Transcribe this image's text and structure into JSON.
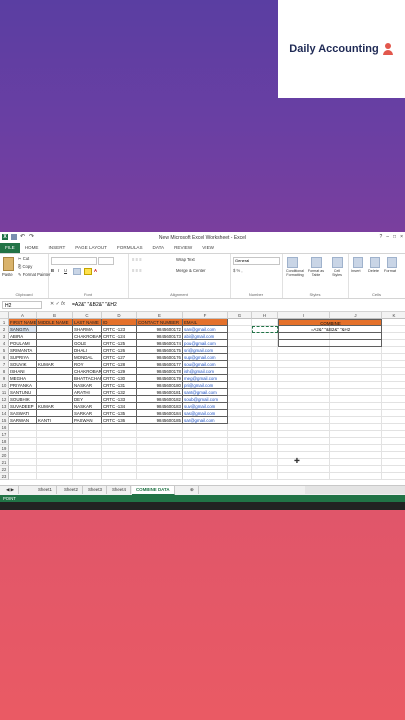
{
  "brand": {
    "name": "Daily Accounting"
  },
  "window": {
    "title": "New Microsoft Excel Worksheet - Excel"
  },
  "ribbon": {
    "tabs": [
      "FILE",
      "HOME",
      "INSERT",
      "PAGE LAYOUT",
      "FORMULAS",
      "DATA",
      "REVIEW",
      "VIEW"
    ],
    "paste": "Paste",
    "cut": "Cut",
    "copy": "Copy",
    "format_painter": "Format Painter",
    "wrap_text": "Wrap Text",
    "merge_center": "Merge & Center",
    "number_format": "General",
    "conditional_formatting": "Conditional Formatting",
    "format_as_table": "Format as Table",
    "cell_styles": "Cell Styles",
    "insert": "Insert",
    "delete": "Delete",
    "format": "Format",
    "groups": [
      "Clipboard",
      "Font",
      "Alignment",
      "Number",
      "Styles",
      "Cells"
    ]
  },
  "formula_bar": {
    "name_box": "H2",
    "fx": "fx",
    "formula": "=A2&\" \"&B2&\" \"&H2"
  },
  "columns": [
    "A",
    "B",
    "C",
    "D",
    "E",
    "F",
    "G",
    "H",
    "I",
    "J",
    "K"
  ],
  "rows": [
    "1",
    "2",
    "3",
    "4",
    "5",
    "6",
    "7",
    "8",
    "9",
    "10",
    "11",
    "12",
    "13",
    "14",
    "15",
    "16",
    "17",
    "18",
    "19",
    "20",
    "21",
    "22",
    "23"
  ],
  "table": {
    "headers": [
      "FIRST NAME",
      "MIDDLE NAME",
      "LAST NAME",
      "ID",
      "CONTACT NUMBER",
      "EMAIL"
    ],
    "rows": [
      [
        "SANGITA",
        "",
        "SHARMA",
        "CRTC -123",
        "9845600172",
        "san@gmail.com"
      ],
      [
        "ABIRA",
        "",
        "CHAKROBARTY",
        "CRTC -124",
        "9845600173",
        "abi@gmail.com"
      ],
      [
        "POULAMI",
        "",
        "GOLE",
        "CRTC -125",
        "9845600174",
        "pou@gmail.com"
      ],
      [
        "SRIMANTA",
        "",
        "DHALI",
        "CRTC -126",
        "9845600175",
        "sri@gmail.com"
      ],
      [
        "SUPRIYA",
        "",
        "MONDAL",
        "CRTC -127",
        "9845600176",
        "sup@gmail.com"
      ],
      [
        "SOUVIK",
        "KUMAR",
        "ROY",
        "CRTC -128",
        "9845600177",
        "sou@gmail.com"
      ],
      [
        "ISHANI",
        "",
        "CHAKROBARTY",
        "CRTC -129",
        "9845600178",
        "ish@gmail.com"
      ],
      [
        "MEGHA",
        "",
        "BHATTACHARYA",
        "CRTC -130",
        "9845600179",
        "meg@gmail.com"
      ],
      [
        "PRIYANKA",
        "",
        "NASKAR",
        "CRTC -131",
        "9845600180",
        "pri@gmail.com"
      ],
      [
        "SANTUNU",
        "",
        "ARATHI",
        "CRTC -132",
        "9845600181",
        "sant@gmail.com"
      ],
      [
        "SOUBHIK",
        "",
        "DEY",
        "CRTC -133",
        "9845600182",
        "soub@gmail.com"
      ],
      [
        "SUVADEEP",
        "KUMAR",
        "NASKAR",
        "CRTC -134",
        "9845600183",
        "suv@gmail.com"
      ],
      [
        "SASWATI",
        "",
        "SARKAR",
        "CRTC -135",
        "9845600184",
        "sas@gmail.com"
      ],
      [
        "SARWAN",
        "KANTI",
        "PASWAN",
        "CRTC -136",
        "9845600185",
        "sar@gmail.com"
      ]
    ]
  },
  "combine": {
    "header": "COMBINE",
    "first_value": "=A2&\" \"&B2&\" \"&H2"
  },
  "sheets": [
    "Sheet1",
    "Sheet2",
    "Sheet3",
    "Sheet4",
    "COMBINE DATA"
  ],
  "status": {
    "mode": "POINT"
  },
  "colors": {
    "header_fill": "#e4712b",
    "excel_green": "#217346",
    "email_link": "#1a4fc2"
  }
}
